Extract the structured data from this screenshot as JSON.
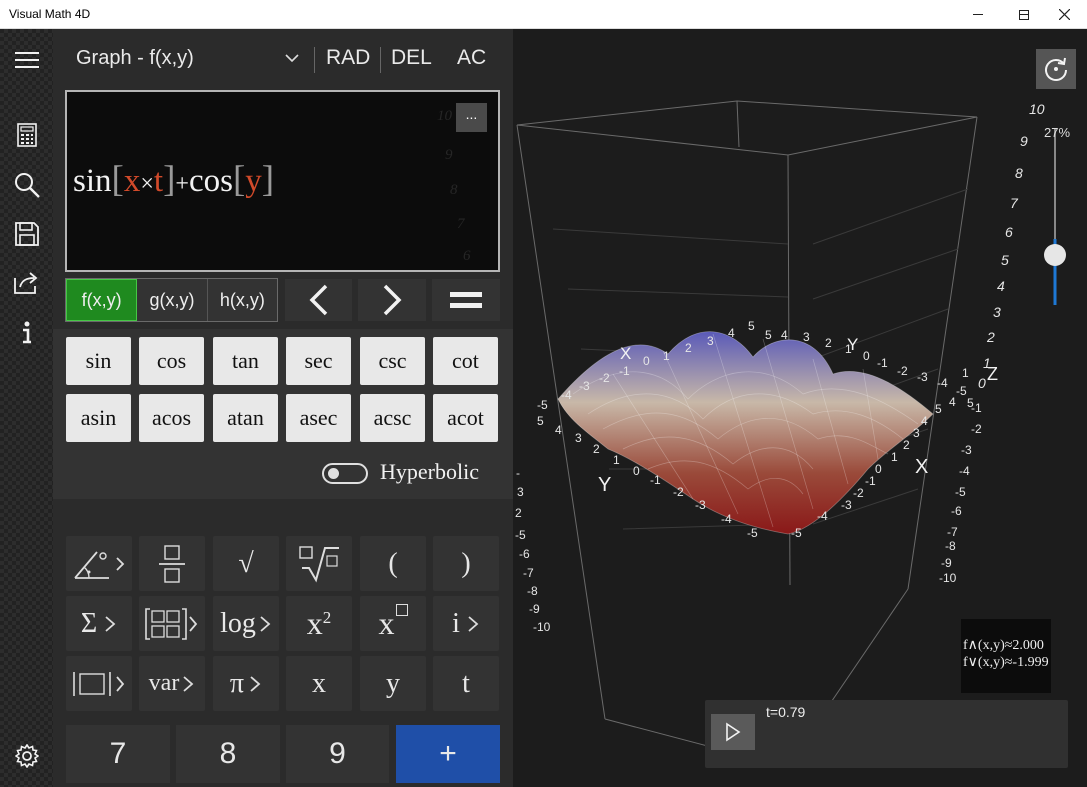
{
  "window": {
    "title": "Visual Math 4D"
  },
  "topbar": {
    "mode": "Graph - f(x,y)",
    "rad": "RAD",
    "del": "DEL",
    "ac": "AC"
  },
  "editor": {
    "menu_label": "...",
    "ghost_numbers": [
      "10",
      "9",
      "8",
      "7",
      "6"
    ],
    "expression": {
      "f1": "sin",
      "v1": "x",
      "op1": "×",
      "v2": "t",
      "plus": "+",
      "f2": "cos",
      "v3": "y"
    }
  },
  "function_tabs": [
    {
      "label": "f(x,y)",
      "active": true
    },
    {
      "label": "g(x,y)",
      "active": false
    },
    {
      "label": "h(x,y)",
      "active": false
    }
  ],
  "trig": {
    "row1": [
      "sin",
      "cos",
      "tan",
      "sec",
      "csc",
      "cot"
    ],
    "row2": [
      "asin",
      "acos",
      "atan",
      "asec",
      "acsc",
      "acot"
    ],
    "hyperbolic_label": "Hyperbolic",
    "hyperbolic_on": false
  },
  "keypad": {
    "row1": [
      "",
      "",
      "√",
      "",
      "(",
      ")"
    ],
    "row2": [
      "Σ",
      "",
      "log",
      "x",
      "x",
      "i"
    ],
    "row3": [
      "",
      "var",
      "π",
      "x",
      "y",
      "t"
    ],
    "numbers": [
      "7",
      "8",
      "9",
      "+"
    ],
    "exponent": "2"
  },
  "graph": {
    "zoom_percent": "27%",
    "zoom_value": 0.27,
    "z_ticks_top": [
      "10",
      "9",
      "8",
      "7",
      "6",
      "5",
      "4",
      "3",
      "2",
      "1",
      "0"
    ],
    "z_label": "Z",
    "x_label": "X",
    "y_label": "Y",
    "readout_max": "f∧(x,y)≈2.000",
    "readout_min": "f∨(x,y)≈-1.999",
    "t_label": "t=0.79",
    "t_value": 0.79,
    "colors": {
      "accent": "#1e78d4",
      "surface_high": "#5a5ab8",
      "surface_low": "#b82a2a",
      "active_tab": "#1f8a1f",
      "plus_button": "#1f4fa8"
    }
  }
}
